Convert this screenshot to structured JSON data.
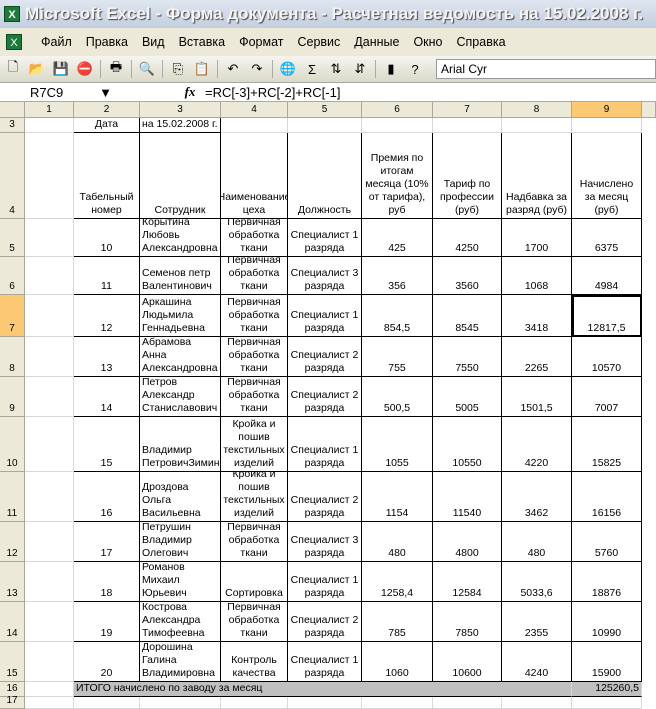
{
  "window": {
    "title": "Microsoft Excel - Форма документа - Расчетная ведомость на 15.02.2008 г."
  },
  "menu": [
    "Файл",
    "Правка",
    "Вид",
    "Вставка",
    "Формат",
    "Сервис",
    "Данные",
    "Окно",
    "Справка"
  ],
  "toolbar": {
    "icons": [
      "new-icon",
      "open-icon",
      "save-icon",
      "permission-icon",
      "print-icon",
      "research-icon",
      "copy-icon",
      "paste-icon",
      "undo-icon",
      "redo-icon",
      "hyperlink-icon",
      "autosum-icon",
      "sort-asc-icon",
      "sort-desc-icon",
      "chart-icon",
      "help-icon"
    ],
    "font": "Arial Cyr"
  },
  "formula_bar": {
    "name_box": "R7C9",
    "fx": "fx",
    "formula": "=RC[-3]+RC[-2]+RC[-1]"
  },
  "columns": [
    "1",
    "2",
    "3",
    "4",
    "5",
    "6",
    "7",
    "8",
    "9"
  ],
  "row3": {
    "num": "3",
    "label": "Дата",
    "date": "на 15.02.2008 г."
  },
  "headers": {
    "num": "4",
    "cols": [
      "Табельный номер",
      "Сотрудник",
      "Наименование цеха",
      "Должность",
      "Премия по итогам месяца (10% от тарифа), руб",
      "Тариф по профессии (руб)",
      "Надбавка за разряд (руб)",
      "Начислено за месяц (руб)"
    ]
  },
  "rows": [
    {
      "num": "5",
      "tab": "10",
      "name": "Корытина Любовь Александровна",
      "shop": "Первичная обработка ткани",
      "pos": "Специалист 1 разряда",
      "bonus": "425",
      "tariff": "4250",
      "extra": "1700",
      "total": "6375"
    },
    {
      "num": "6",
      "tab": "11",
      "name": "Семенов петр Валентинович",
      "shop": "Первичная обработка ткани",
      "pos": "Специалист 3 разряда",
      "bonus": "356",
      "tariff": "3560",
      "extra": "1068",
      "total": "4984"
    },
    {
      "num": "7",
      "tab": "12",
      "name": "Аркашина Людьмила Геннадьевна",
      "shop": "Первичная обработка ткани",
      "pos": "Специалист 1 разряда",
      "bonus": "854,5",
      "tariff": "8545",
      "extra": "3418",
      "total": "12817,5"
    },
    {
      "num": "8",
      "tab": "13",
      "name": "Абрамова Анна Александровна",
      "shop": "Первичная обработка ткани",
      "pos": "Специалист 2 разряда",
      "bonus": "755",
      "tariff": "7550",
      "extra": "2265",
      "total": "10570"
    },
    {
      "num": "9",
      "tab": "14",
      "name": "Петров Александр Станиславович",
      "shop": "Первичная обработка ткани",
      "pos": "Специалист 2 разряда",
      "bonus": "500,5",
      "tariff": "5005",
      "extra": "1501,5",
      "total": "7007"
    },
    {
      "num": "10",
      "tab": "15",
      "name": "Владимир ПетровичЗимин",
      "shop": "Кройка и пошив текстильных изделий",
      "pos": "Специалист 1 разряда",
      "bonus": "1055",
      "tariff": "10550",
      "extra": "4220",
      "total": "15825"
    },
    {
      "num": "11",
      "tab": "16",
      "name": "Дроздова Ольга Васильевна",
      "shop": "Кройка и пошив текстильных изделий",
      "pos": "Специалист 2 разряда",
      "bonus": "1154",
      "tariff": "11540",
      "extra": "3462",
      "total": "16156"
    },
    {
      "num": "12",
      "tab": "17",
      "name": "Петрушин Владимир Олегович",
      "shop": "Первичная обработка ткани",
      "pos": "Специалист 3 разряда",
      "bonus": "480",
      "tariff": "4800",
      "extra": "480",
      "total": "5760"
    },
    {
      "num": "13",
      "tab": "18",
      "name": "Романов Михаил Юрьевич",
      "shop": "Сортировка",
      "pos": "Специалист 1 разряда",
      "bonus": "1258,4",
      "tariff": "12584",
      "extra": "5033,6",
      "total": "18876"
    },
    {
      "num": "14",
      "tab": "19",
      "name": "Кострова Александра Тимофеевна",
      "shop": "Первичная обработка ткани",
      "pos": "Специалист 2 разряда",
      "bonus": "785",
      "tariff": "7850",
      "extra": "2355",
      "total": "10990"
    },
    {
      "num": "15",
      "tab": "20",
      "name": "Дорошина Галина Владимировна",
      "shop": "Контроль качества",
      "pos": "Специалист 1 разряда",
      "bonus": "1060",
      "tariff": "10600",
      "extra": "4240",
      "total": "15900"
    }
  ],
  "total_row": {
    "num": "16",
    "label": "ИТОГО начислено по заводу за месяц",
    "value": "125260,5"
  },
  "row17": {
    "num": "17"
  }
}
